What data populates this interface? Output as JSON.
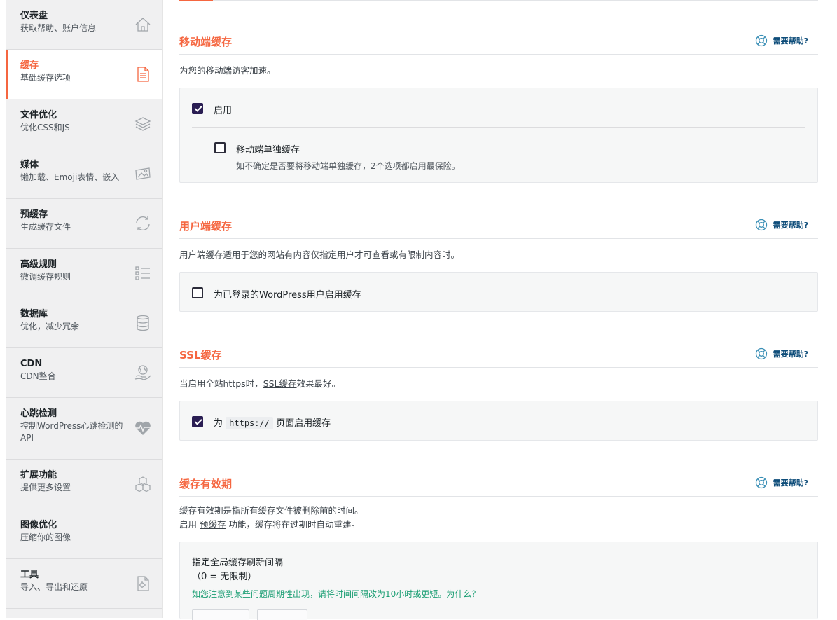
{
  "sidebar": {
    "items": [
      {
        "title": "仪表盘",
        "sub": "获取帮助、账户信息",
        "icon": "home-icon"
      },
      {
        "title": "缓存",
        "sub": "基础缓存选项",
        "icon": "document-icon"
      },
      {
        "title": "文件优化",
        "sub": "优化CSS和JS",
        "icon": "layers-icon"
      },
      {
        "title": "媒体",
        "sub": "懒加载、Emoji表情、嵌入",
        "icon": "image-icon"
      },
      {
        "title": "预缓存",
        "sub": "生成缓存文件",
        "icon": "refresh-icon"
      },
      {
        "title": "高级规则",
        "sub": "微调缓存规则",
        "icon": "list-icon"
      },
      {
        "title": "数据库",
        "sub": "优化，减少冗余",
        "icon": "database-icon"
      },
      {
        "title": "CDN",
        "sub": "CDN整合",
        "icon": "globe-hand-icon"
      },
      {
        "title": "心跳检测",
        "sub": "控制WordPress心跳检测的API",
        "icon": "heartbeat-icon"
      },
      {
        "title": "扩展功能",
        "sub": "提供更多设置",
        "icon": "cubes-icon"
      },
      {
        "title": "图像优化",
        "sub": "压缩你的图像",
        "icon": "image-optimize-icon"
      },
      {
        "title": "工具",
        "sub": "导入、导出和还原",
        "icon": "tools-file-icon"
      }
    ]
  },
  "help_label": "需要帮助?",
  "mobile": {
    "title": "移动端缓存",
    "desc": "为您的移动端访客加速。",
    "enable_label": "启用",
    "enable_checked": true,
    "separate_label": "移动端单独缓存",
    "separate_checked": false,
    "note_prefix": "如不确定是否要将",
    "note_link": "移动端单独缓存",
    "note_suffix": "，2个选项都启用最保险。"
  },
  "user": {
    "title": "用户端缓存",
    "desc_link": "用户端缓存",
    "desc_rest": "适用于您的网站有内容仅指定用户才可查看或有限制内容时。",
    "option_label": "为已登录的WordPress用户启用缓存",
    "option_checked": false
  },
  "ssl": {
    "title": "SSL缓存",
    "desc_prefix": "当启用全站https时，",
    "desc_link": "SSL缓存",
    "desc_suffix": "效果最好。",
    "option_prefix": "为",
    "option_code": "https://",
    "option_suffix": "页面启用缓存",
    "option_checked": true
  },
  "lifespan": {
    "title": "缓存有效期",
    "desc1": "缓存有效期是指所有缓存文件被删除前的时间。",
    "desc2_prefix": "启用",
    "desc2_link": "预缓存",
    "desc2_suffix": "功能，缓存将在过期时自动重建。",
    "field_label": "指定全局缓存刷新间隔",
    "field_hint": "（0 = 无限制）",
    "warning_text": "如您注意到某些问题周期性出现，请将时间间隔改为10小时或更短。",
    "warning_link": "为什么？"
  },
  "colors": {
    "accent": "#f56640",
    "checkbox": "#2a1e53",
    "help": "#0e4d7a",
    "warning": "#1a9e73"
  }
}
